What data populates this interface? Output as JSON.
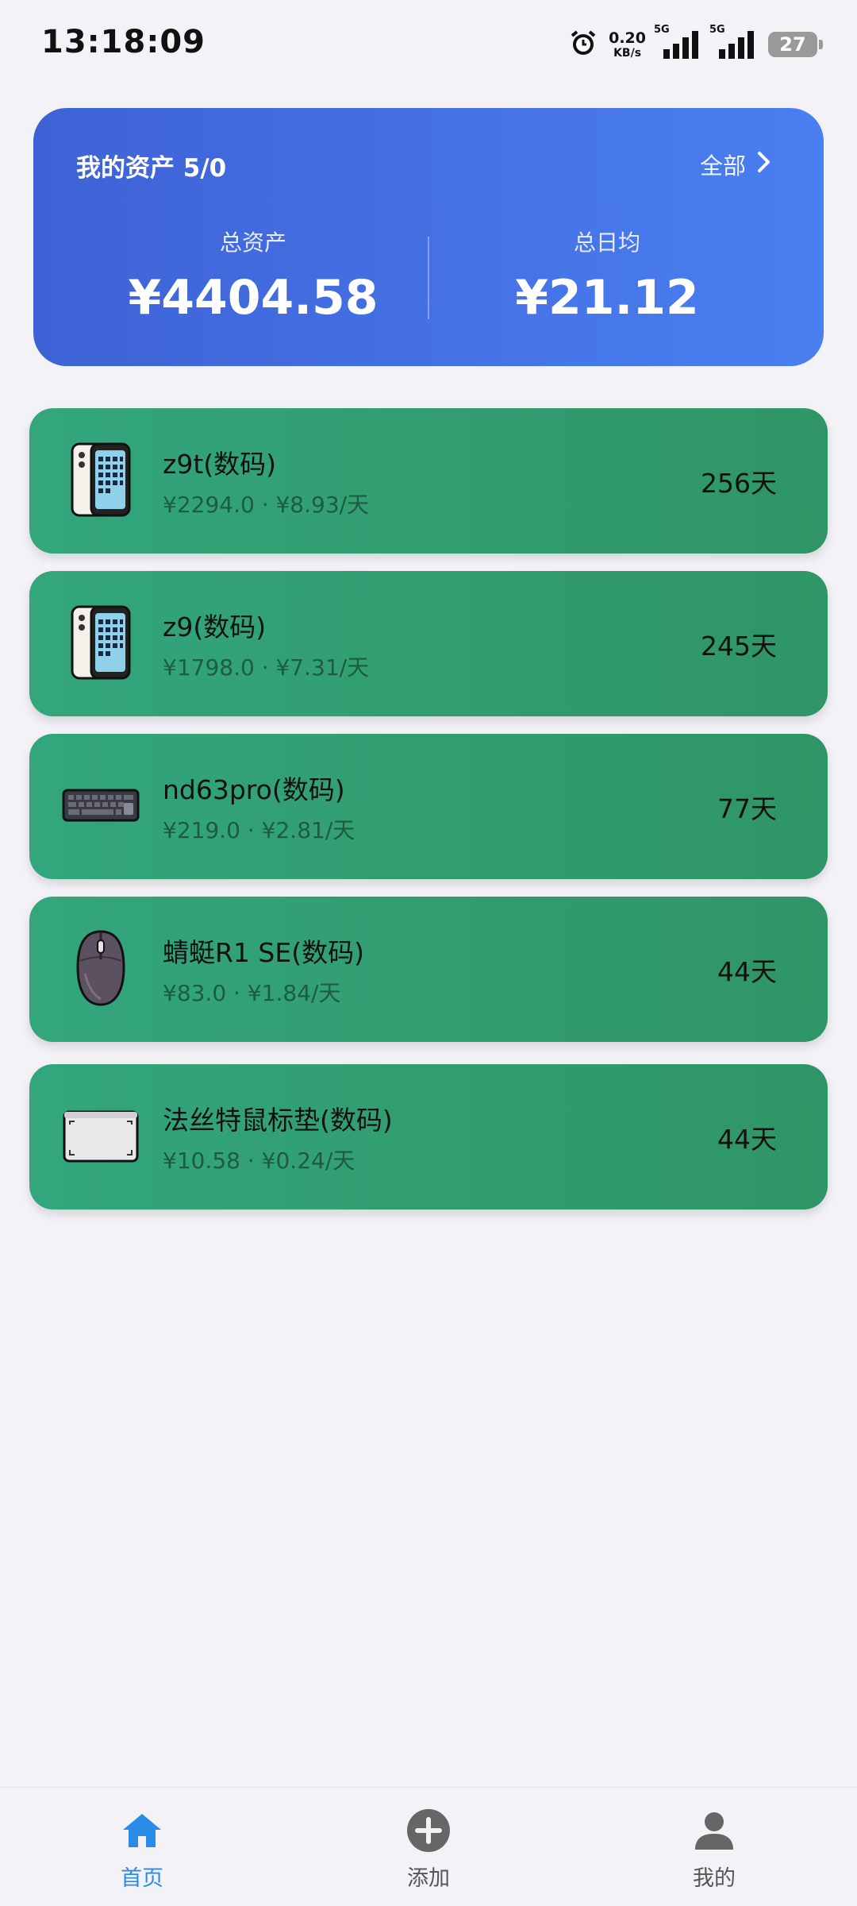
{
  "status_bar": {
    "time": "13:18:09",
    "net_speed_value": "0.20",
    "net_speed_unit": "KB/s",
    "sim1_tag": "5G",
    "sim2_tag": "5G",
    "battery": "27",
    "icons": [
      "alarm-icon",
      "signal-icon",
      "signal-icon",
      "battery-icon"
    ]
  },
  "summary": {
    "title": "我的资产 5/0",
    "all_label": "全部",
    "total_label": "总资产",
    "total_value": "¥4404.58",
    "daily_label": "总日均",
    "daily_value": "¥21.12",
    "gradient": [
      "#3e62d6",
      "#4a7ff1"
    ]
  },
  "assets": [
    {
      "name": "z9t(数码)",
      "detail": "¥2294.0 · ¥8.93/天",
      "days": "256天",
      "icon": "phone-icon"
    },
    {
      "name": "z9(数码)",
      "detail": "¥1798.0 · ¥7.31/天",
      "days": "245天",
      "icon": "phone-icon"
    },
    {
      "name": "nd63pro(数码)",
      "detail": "¥219.0 · ¥2.81/天",
      "days": "77天",
      "icon": "keyboard-icon"
    },
    {
      "name": "蜻蜓R1 SE(数码)",
      "detail": "¥83.0 · ¥1.84/天",
      "days": "44天",
      "icon": "mouse-icon"
    },
    {
      "name": "法丝特鼠标垫(数码)",
      "detail": "¥10.58 · ¥0.24/天",
      "days": "44天",
      "icon": "mousepad-icon"
    }
  ],
  "nav": {
    "home": "首页",
    "add": "添加",
    "mine": "我的",
    "active_color": "#2a8be8",
    "inactive_color": "#666666"
  },
  "colors": {
    "background": "#f2f2f7",
    "card_green": "#31a070"
  }
}
